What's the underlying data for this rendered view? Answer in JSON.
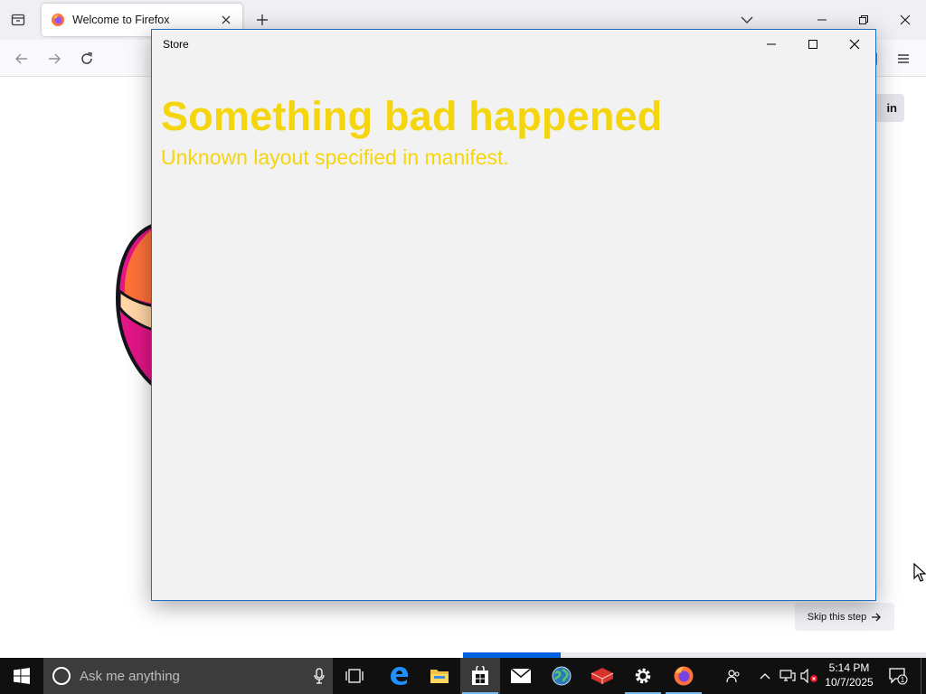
{
  "firefox": {
    "tab": {
      "title": "Welcome to Firefox"
    },
    "signin_label": "in",
    "skip_label": "Skip this step",
    "onboarding_progress": 0.21
  },
  "store": {
    "window_title": "Store",
    "error_title": "Something bad happened",
    "error_message": "Unknown layout specified in manifest.",
    "error_color": "#f5d50e"
  },
  "taskbar": {
    "search_placeholder": "Ask me anything",
    "apps": [
      {
        "name": "task-view-icon"
      },
      {
        "name": "edge-icon"
      },
      {
        "name": "file-explorer-icon"
      },
      {
        "name": "store-icon",
        "active": true
      },
      {
        "name": "mail-icon"
      },
      {
        "name": "globe-app-icon"
      },
      {
        "name": "red-app-icon"
      },
      {
        "name": "settings-icon"
      },
      {
        "name": "firefox-icon"
      }
    ],
    "clock": {
      "time": "5:14 PM",
      "date": "10/7/2025"
    },
    "notification_count": "1"
  },
  "colors": {
    "taskbar": "#101010",
    "accent": "#0060df",
    "window_border": "#1f6fc5"
  }
}
